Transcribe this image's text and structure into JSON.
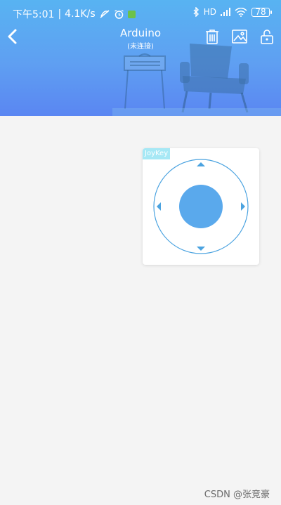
{
  "status_bar": {
    "time": "下午5:01",
    "net_speed": "4.1K/s",
    "battery": "78",
    "network": "HD"
  },
  "header": {
    "title": "Arduino",
    "subtitle": "(未连接)"
  },
  "widget": {
    "label": "JoyKey"
  },
  "watermark": "CSDN @张竞豪",
  "colors": {
    "header_top": "#58b3f2",
    "header_bottom": "#5a86f2",
    "joystick": "#5aa9ec",
    "background": "#f4f4f4"
  },
  "icons": {
    "back": "chevron-left-icon",
    "delete": "trash-icon",
    "background": "image-icon",
    "lock": "unlock-icon"
  }
}
